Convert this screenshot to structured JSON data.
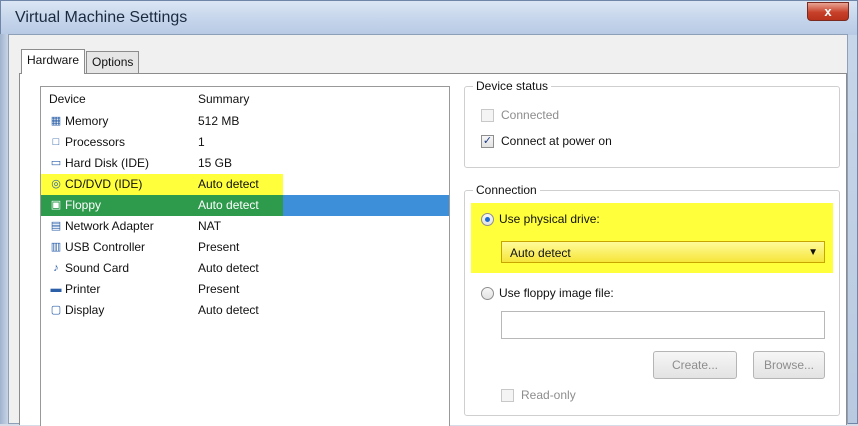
{
  "window": {
    "title": "Virtual Machine Settings",
    "close_label": "x"
  },
  "tabs": [
    {
      "label": "Hardware",
      "active": true
    },
    {
      "label": "Options",
      "active": false
    }
  ],
  "device_list": {
    "columns": {
      "device": "Device",
      "summary": "Summary"
    },
    "rows": [
      {
        "icon": "memory-icon",
        "glyph": "▦",
        "device": "Memory",
        "summary": "512 MB",
        "state": "normal"
      },
      {
        "icon": "processor-icon",
        "glyph": "□",
        "device": "Processors",
        "summary": "1",
        "state": "normal"
      },
      {
        "icon": "hard-disk-icon",
        "glyph": "▭",
        "device": "Hard Disk (IDE)",
        "summary": "15 GB",
        "state": "normal"
      },
      {
        "icon": "cd-dvd-icon",
        "glyph": "◎",
        "device": "CD/DVD (IDE)",
        "summary": "Auto detect",
        "state": "highlight"
      },
      {
        "icon": "floppy-icon",
        "glyph": "▣",
        "device": "Floppy",
        "summary": "Auto detect",
        "state": "selected"
      },
      {
        "icon": "network-adapter-icon",
        "glyph": "▤",
        "device": "Network Adapter",
        "summary": "NAT",
        "state": "normal"
      },
      {
        "icon": "usb-controller-icon",
        "glyph": "▥",
        "device": "USB Controller",
        "summary": "Present",
        "state": "normal"
      },
      {
        "icon": "sound-card-icon",
        "glyph": "♪",
        "device": "Sound Card",
        "summary": "Auto detect",
        "state": "normal"
      },
      {
        "icon": "printer-icon",
        "glyph": "▬",
        "device": "Printer",
        "summary": "Present",
        "state": "normal"
      },
      {
        "icon": "display-icon",
        "glyph": "▢",
        "device": "Display",
        "summary": "Auto detect",
        "state": "normal"
      }
    ]
  },
  "device_status": {
    "title": "Device status",
    "connected": {
      "label": "Connected",
      "checked": false,
      "disabled": true
    },
    "connect_at_power_on": {
      "label": "Connect at power on",
      "checked": true,
      "disabled": false
    }
  },
  "connection": {
    "title": "Connection",
    "use_physical_drive": {
      "label": "Use physical drive:",
      "selected": true
    },
    "drive_select": {
      "value": "Auto detect"
    },
    "use_image_file": {
      "label": "Use floppy image file:",
      "selected": false
    },
    "image_path": {
      "value": ""
    },
    "create_label": "Create...",
    "browse_label": "Browse...",
    "read_only": {
      "label": "Read-only",
      "checked": false,
      "disabled": true
    }
  },
  "colors": {
    "highlight_yellow": "#ffff3c",
    "selection_blue": "#3c8fd8",
    "selection_green": "#2e9a4c"
  }
}
